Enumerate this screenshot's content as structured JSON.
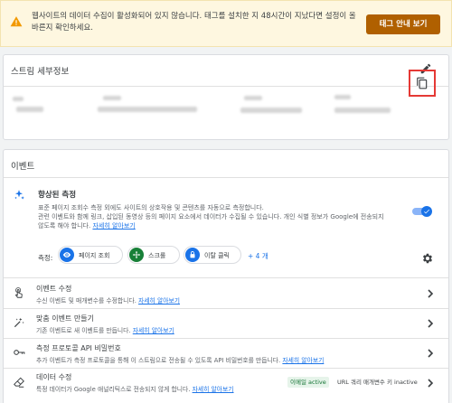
{
  "banner": {
    "text": "웹사이트의 데이터 수집이 활성화되어 있지 않습니다. 태그를 설치한 지 48시간이 지났다면 설정이 올바른지 확인하세요.",
    "button_label": "태그 안내 보기"
  },
  "stream_details": {
    "title": "스트림 세부정보"
  },
  "events": {
    "title": "이벤트",
    "enhanced": {
      "title": "향상된 측정",
      "desc_line1": "표준 페이지 조회수 측정 외에도 사이트의 상호작용 및 콘텐츠를 자동으로 측정합니다.",
      "desc_line2": "관련 이벤트와 함께 링크, 삽입된 동영상 등의 페이지 요소에서 데이터가 수집될 수 있습니다. 개인 식별 정보가 Google에 전송되지",
      "desc_line3": "않도록 해야 합니다.",
      "learn_more": "자세히 알아보기",
      "toggle_on": true,
      "measure_label": "측정:",
      "chips": [
        {
          "label": "페이지 조회",
          "color": "#1a73e8",
          "icon": "eye-icon"
        },
        {
          "label": "스크롤",
          "color": "#188038",
          "icon": "crosshair-icon"
        },
        {
          "label": "이탈 클릭",
          "color": "#1a73e8",
          "icon": "lock-icon"
        }
      ],
      "more_label": "+ 4 개"
    },
    "rows": [
      {
        "title": "이벤트 수정",
        "desc": "수신 이벤트 및 매개변수를 수정합니다.",
        "link": "자세히 알아보기"
      },
      {
        "title": "맞춤 이벤트 만들기",
        "desc": "기존 이벤트로 새 이벤트를 만듭니다.",
        "link": "자세히 알아보기"
      },
      {
        "title": "측정 프로토콜 API 비밀번호",
        "desc": "추가 이벤트가 측정 프로토콜을 통해 이 스트림으로 전송될 수 있도록 API 비밀번호를 만듭니다.",
        "link": "자세히 알아보기"
      },
      {
        "title": "데이터 수정",
        "desc": "특정 데이터가 Google 애널리틱스로 전송되지 않게 합니다.",
        "link": "자세히 알아보기"
      }
    ],
    "redaction": {
      "email_badge": "이메일 active",
      "url_badge": "URL 쿼리 매개변수 키 inactive"
    }
  },
  "colors": {
    "accent": "#1a73e8",
    "banner_button": "#b06000",
    "highlight": "#e53935"
  }
}
